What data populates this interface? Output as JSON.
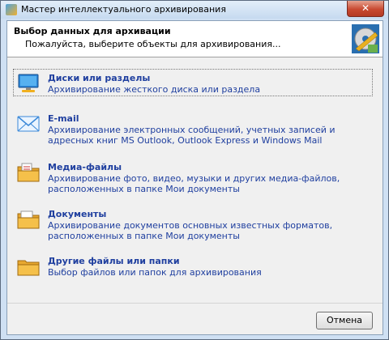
{
  "window": {
    "title": "Мастер интеллектуального архивирования",
    "close_glyph": "✕"
  },
  "header": {
    "title": "Выбор данных для архивации",
    "subtitle": "Пожалуйста, выберите объекты для архивирования...",
    "art_icon": "archive-disc-icon"
  },
  "options": [
    {
      "title": "Диски или разделы",
      "description": "Архивирование жесткого диска или раздела",
      "icon": "monitor-icon",
      "selected": true
    },
    {
      "title": "E-mail",
      "description": "Архивирование электронных сообщений, учетных записей и адресных книг MS Outlook, Outlook Express и Windows Mail",
      "icon": "envelope-icon"
    },
    {
      "title": "Медиа-файлы",
      "description": "Архивирование фото, видео, музыки и других медиа-файлов, расположенных в папке Мои документы",
      "icon": "media-folder-icon"
    },
    {
      "title": "Документы",
      "description": "Архивирование документов основных известных форматов, расположенных в папке Мои документы",
      "icon": "documents-folder-icon"
    },
    {
      "title": "Другие файлы или папки",
      "description": "Выбор файлов или папок для архивирования",
      "icon": "folder-icon"
    }
  ],
  "footer": {
    "cancel_label": "Отмена"
  },
  "colors": {
    "link_blue": "#1f3f9f",
    "close_red": "#c84a32"
  }
}
